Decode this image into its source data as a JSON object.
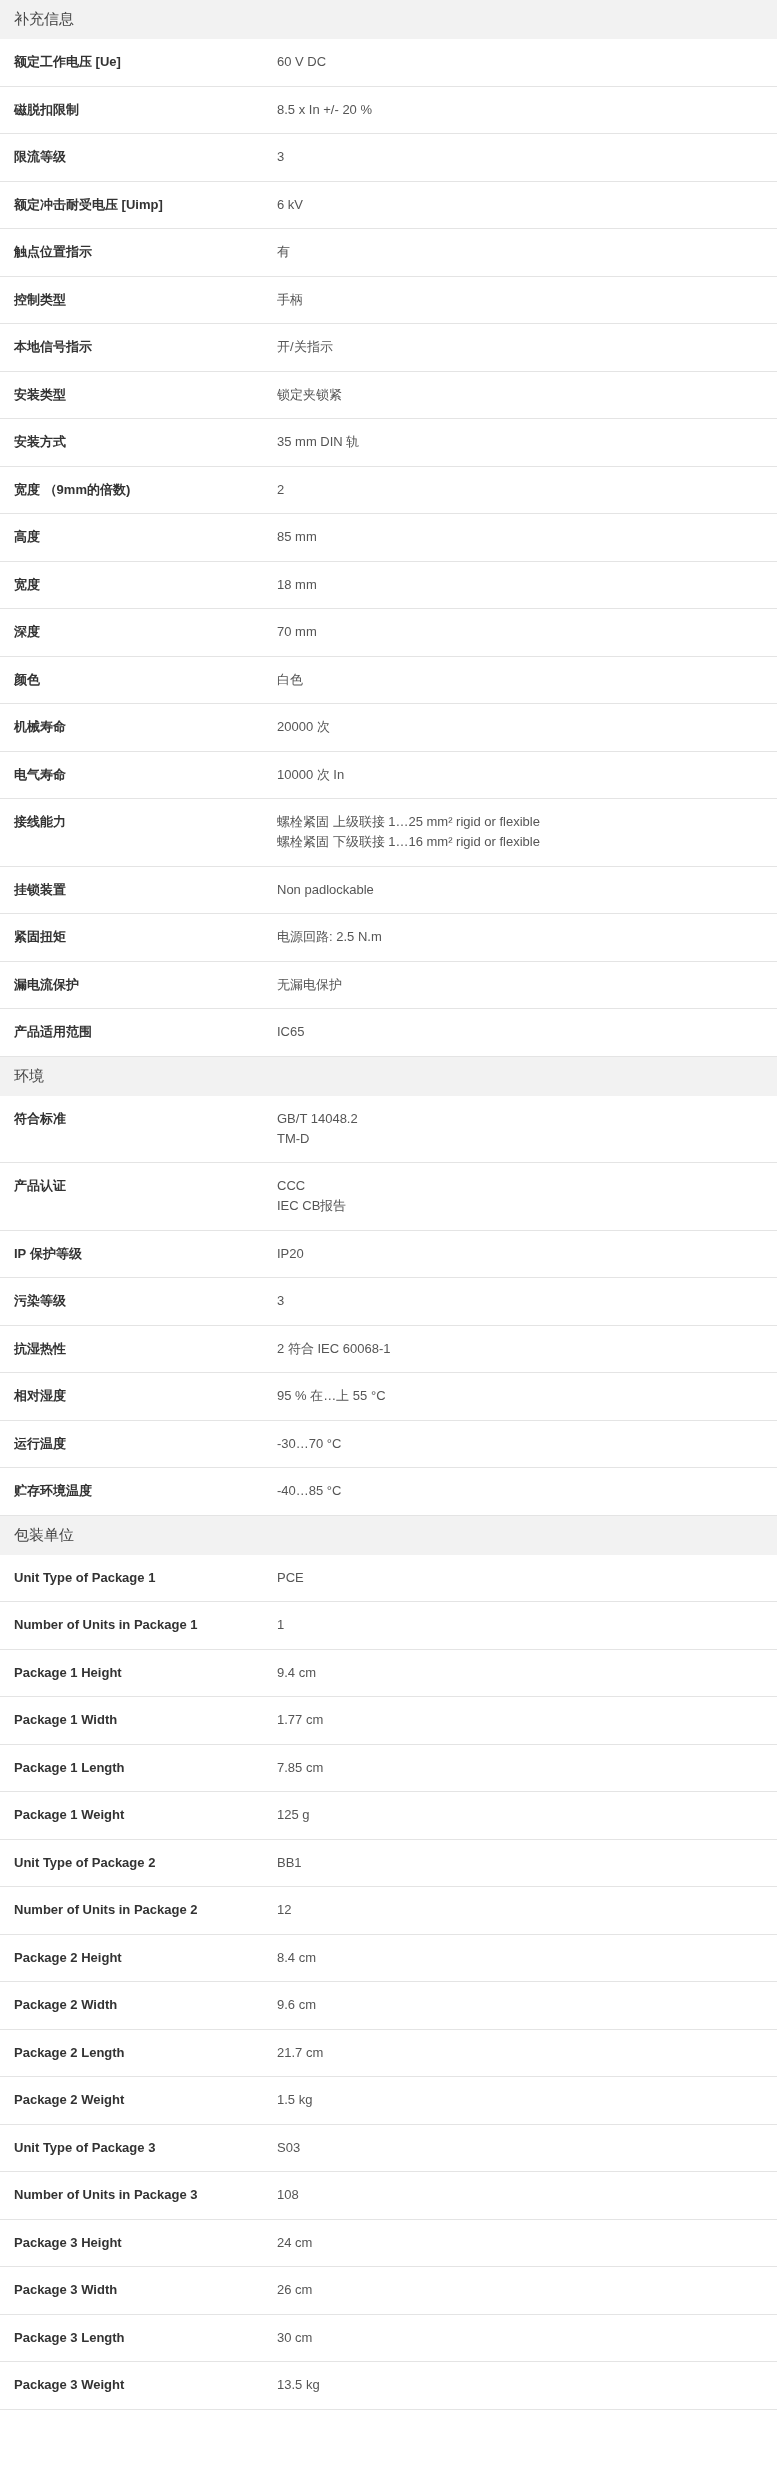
{
  "sections": [
    {
      "title": "补充信息",
      "rows": [
        {
          "label": "额定工作电压 [Ue]",
          "values": [
            "60 V DC"
          ]
        },
        {
          "label": "磁脱扣限制",
          "values": [
            "8.5 x In +/- 20 %"
          ]
        },
        {
          "label": "限流等级",
          "values": [
            "3"
          ]
        },
        {
          "label": "额定冲击耐受电压 [Uimp]",
          "values": [
            "6 kV"
          ]
        },
        {
          "label": "触点位置指示",
          "values": [
            "有"
          ]
        },
        {
          "label": "控制类型",
          "values": [
            "手柄"
          ]
        },
        {
          "label": "本地信号指示",
          "values": [
            "开/关指示"
          ]
        },
        {
          "label": "安装类型",
          "values": [
            "锁定夹锁紧"
          ]
        },
        {
          "label": "安装方式",
          "values": [
            "35 mm DIN 轨"
          ]
        },
        {
          "label": "宽度 （9mm的倍数)",
          "values": [
            "2"
          ]
        },
        {
          "label": "高度",
          "values": [
            "85 mm"
          ]
        },
        {
          "label": "宽度",
          "values": [
            "18 mm"
          ]
        },
        {
          "label": "深度",
          "values": [
            "70 mm"
          ]
        },
        {
          "label": "颜色",
          "values": [
            "白色"
          ]
        },
        {
          "label": "机械寿命",
          "values": [
            "20000 次"
          ]
        },
        {
          "label": "电气寿命",
          "values": [
            "10000 次 In"
          ]
        },
        {
          "label": "接线能力",
          "values": [
            "螺栓紧固 上级联接 1…25 mm² rigid or flexible",
            "螺栓紧固 下级联接 1…16 mm² rigid or flexible"
          ]
        },
        {
          "label": "挂锁装置",
          "values": [
            "Non padlockable"
          ]
        },
        {
          "label": "紧固扭矩",
          "values": [
            "电源回路: 2.5 N.m"
          ]
        },
        {
          "label": "漏电流保护",
          "values": [
            "无漏电保护"
          ]
        },
        {
          "label": "产品适用范围",
          "values": [
            "IC65"
          ]
        }
      ]
    },
    {
      "title": "环境",
      "rows": [
        {
          "label": "符合标准",
          "values": [
            "GB/T 14048.2",
            "TM-D"
          ]
        },
        {
          "label": "产品认证",
          "values": [
            "CCC",
            "IEC CB报告"
          ]
        },
        {
          "label": "IP 保护等级",
          "values": [
            "IP20"
          ]
        },
        {
          "label": "污染等级",
          "values": [
            "3"
          ]
        },
        {
          "label": "抗湿热性",
          "values": [
            "2 符合 IEC 60068-1"
          ]
        },
        {
          "label": "相对湿度",
          "values": [
            "95 % 在…上 55 °C"
          ]
        },
        {
          "label": "运行温度",
          "values": [
            "-30…70 °C"
          ]
        },
        {
          "label": "贮存环境温度",
          "values": [
            "-40…85 °C"
          ]
        }
      ]
    },
    {
      "title": "包装单位",
      "rows": [
        {
          "label": "Unit Type of Package 1",
          "values": [
            "PCE"
          ]
        },
        {
          "label": "Number of Units in Package 1",
          "values": [
            "1"
          ]
        },
        {
          "label": "Package 1 Height",
          "values": [
            "9.4 cm"
          ]
        },
        {
          "label": "Package 1 Width",
          "values": [
            "1.77 cm"
          ]
        },
        {
          "label": "Package 1 Length",
          "values": [
            "7.85 cm"
          ]
        },
        {
          "label": "Package 1 Weight",
          "values": [
            "125 g"
          ]
        },
        {
          "label": "Unit Type of Package 2",
          "values": [
            "BB1"
          ]
        },
        {
          "label": "Number of Units in Package 2",
          "values": [
            "12"
          ]
        },
        {
          "label": "Package 2 Height",
          "values": [
            "8.4 cm"
          ]
        },
        {
          "label": "Package 2 Width",
          "values": [
            "9.6 cm"
          ]
        },
        {
          "label": "Package 2 Length",
          "values": [
            "21.7 cm"
          ]
        },
        {
          "label": "Package 2 Weight",
          "values": [
            "1.5 kg"
          ]
        },
        {
          "label": "Unit Type of Package 3",
          "values": [
            "S03"
          ]
        },
        {
          "label": "Number of Units in Package 3",
          "values": [
            "108"
          ]
        },
        {
          "label": "Package 3 Height",
          "values": [
            "24 cm"
          ]
        },
        {
          "label": "Package 3 Width",
          "values": [
            "26 cm"
          ]
        },
        {
          "label": "Package 3 Length",
          "values": [
            "30 cm"
          ]
        },
        {
          "label": "Package 3 Weight",
          "values": [
            "13.5 kg"
          ]
        }
      ]
    }
  ]
}
